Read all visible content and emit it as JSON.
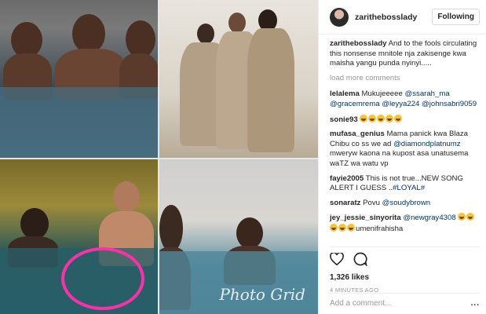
{
  "post": {
    "username": "zarithebosslady",
    "follow_label": "Following",
    "caption_user": "zarithebosslady",
    "caption": " And to the fools circulating this nonsense mnitole nja zakisenge kwa maisha yangu punda nyinyi.....",
    "load_more": "load more comments",
    "comments": [
      {
        "user": "lelalema",
        "text": " Mukujeeeee ",
        "mentions": "@ssarah_ma @gracemrema @leyya224 @johnsabri9059"
      },
      {
        "user": "sonie93",
        "emoji_count": 5
      },
      {
        "user": "mufasa_genius",
        "text": " Mama panick kwa Blaza Chibu co ss we ad ",
        "mentions": "@diamondplatnumz",
        "text2": " mweryw kaona na kupost asa unatusema waTZ wa watu vp"
      },
      {
        "user": "fayie2005",
        "text": " This is not true...NEW SONG ALERT I GUESS ..",
        "mentions": "#LOYAL#"
      },
      {
        "user": "sonaratz",
        "text": " Povu ",
        "mentions": "@soudybrown"
      },
      {
        "user": "jey_jessie_sinyorita",
        "mentions": "@newgray4308",
        "text2": "umenifrahisha"
      }
    ],
    "likes": "1,326 likes",
    "timestamp": "4 MINUTES AGO",
    "add_comment_placeholder": "Add a comment...",
    "more_label": "..."
  },
  "watermark": "Photo Grid",
  "icons": {
    "like": "heart-icon",
    "comment": "comment-icon",
    "avatar": "profile-avatar"
  },
  "colors": {
    "accent": "#003569",
    "highlight_circle": "#ff2fa8",
    "muted": "#999999"
  }
}
